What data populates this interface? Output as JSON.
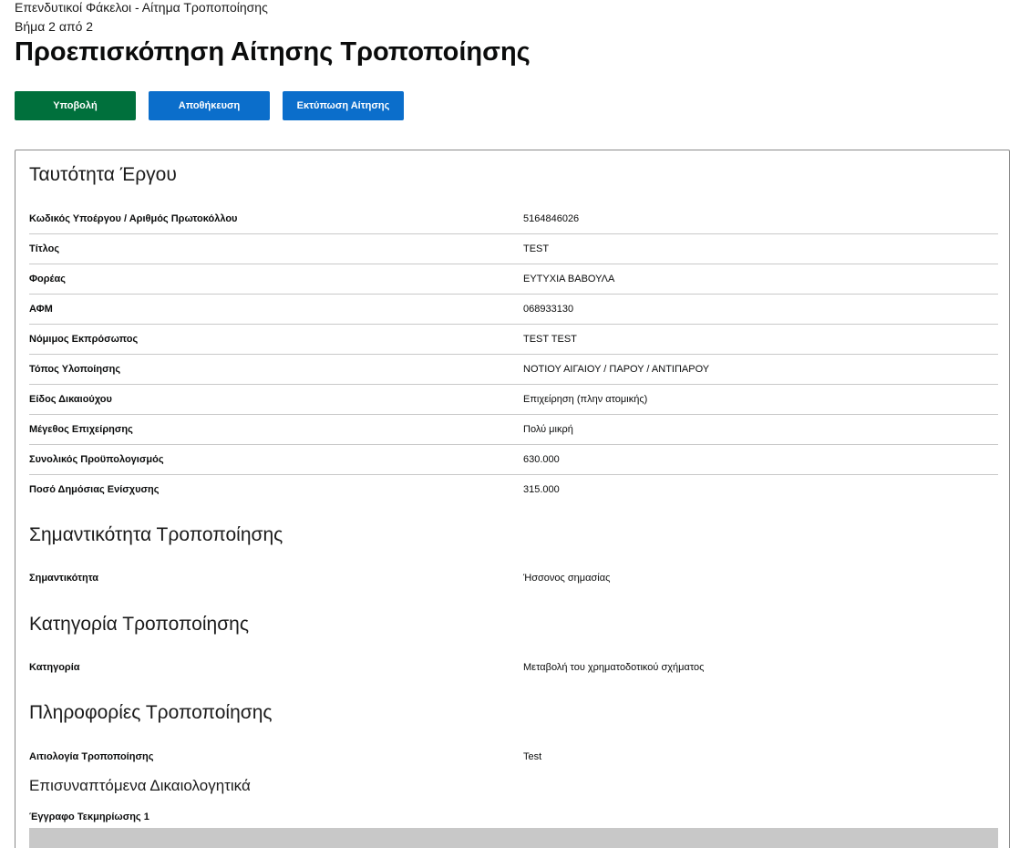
{
  "header": {
    "breadcrumb": "Επενδυτικοί Φάκελοι - Αίτημα Τροποποίησης",
    "step": "Βήμα 2 από 2",
    "title": "Προεπισκόπηση Αίτησης Τροποποίησης"
  },
  "actions": {
    "submit": "Υποβολή",
    "save": "Αποθήκευση",
    "print": "Εκτύπωση Αίτησης"
  },
  "colors": {
    "submit": "#00703c",
    "primary": "#0b6ecb"
  },
  "project": {
    "title": "Ταυτότητα Έργου",
    "rows": [
      {
        "label": "Κωδικός Υποέργου / Αριθμός Πρωτοκόλλου",
        "value": "5164846026"
      },
      {
        "label": "Τίτλος",
        "value": "TEST"
      },
      {
        "label": "Φορέας",
        "value": "ΕΥΤΥΧΙΑ ΒΑΒΟΥΛΑ"
      },
      {
        "label": "ΑΦΜ",
        "value": "068933130"
      },
      {
        "label": "Νόμιμος Εκπρόσωπος",
        "value": "TEST TEST"
      },
      {
        "label": "Τόπος Υλοποίησης",
        "value": "ΝΟΤΙΟΥ ΑΙΓΑΙΟΥ / ΠΑΡΟΥ / ΑΝΤΙΠΑΡΟΥ"
      },
      {
        "label": "Είδος Δικαιούχου",
        "value": "Επιχείρηση (πλην ατομικής)"
      },
      {
        "label": "Μέγεθος Επιχείρησης",
        "value": "Πολύ μικρή"
      },
      {
        "label": "Συνολικός Προϋπολογισμός",
        "value": "630.000"
      },
      {
        "label": "Ποσό Δημόσιας Ενίσχυσης",
        "value": "315.000"
      }
    ]
  },
  "importance": {
    "title": "Σημαντικότητα Τροποποίησης",
    "label": "Σημαντικότητα",
    "value": "Ήσσονος σημασίας"
  },
  "category": {
    "title": "Κατηγορία Τροποποίησης",
    "label": "Κατηγορία",
    "value": "Μεταβολή του χρηματοδοτικού σχήματος"
  },
  "info": {
    "title": "Πληροφορίες Τροποποίησης",
    "label": "Αιτιολογία Τροποποίησης",
    "value": "Test"
  },
  "attachments": {
    "title": "Επισυναπτόμενα Δικαιολογητικά",
    "doc_label": "Έγγραφο Τεκμηρίωσης 1"
  }
}
